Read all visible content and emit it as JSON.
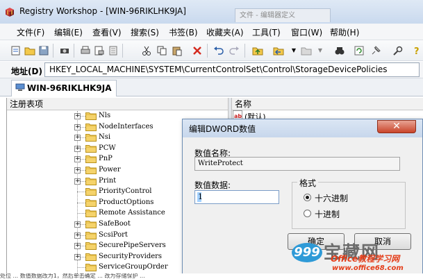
{
  "window": {
    "title": "Registry Workshop - [WIN-96RIKLHK9JA]",
    "background_tab": "文件 - 编辑器定义"
  },
  "menu": [
    {
      "label": "文件(F)"
    },
    {
      "label": "编辑(E)"
    },
    {
      "label": "查看(V)"
    },
    {
      "label": "搜索(S)"
    },
    {
      "label": "书签(B)"
    },
    {
      "label": "收藏夹(A)"
    },
    {
      "label": "工具(T)"
    },
    {
      "label": "窗口(W)"
    },
    {
      "label": "帮助(H)"
    }
  ],
  "address": {
    "label": "地址(D)",
    "path": "HKEY_LOCAL_MACHINE\\SYSTEM\\CurrentControlSet\\Control\\StorageDevicePolicies"
  },
  "host_tab": "WIN-96RIKLHK9JA",
  "left_pane": {
    "header": "注册表项"
  },
  "right_pane": {
    "header": "名称",
    "value_name": "(默认)"
  },
  "tree": [
    {
      "label": "Nls",
      "expandable": true
    },
    {
      "label": "NodeInterfaces",
      "expandable": true
    },
    {
      "label": "Nsi",
      "expandable": true
    },
    {
      "label": "PCW",
      "expandable": true
    },
    {
      "label": "PnP",
      "expandable": true
    },
    {
      "label": "Power",
      "expandable": true
    },
    {
      "label": "Print",
      "expandable": true
    },
    {
      "label": "PriorityControl",
      "expandable": false
    },
    {
      "label": "ProductOptions",
      "expandable": false
    },
    {
      "label": "Remote Assistance",
      "expandable": false
    },
    {
      "label": "SafeBoot",
      "expandable": true
    },
    {
      "label": "ScsiPort",
      "expandable": true
    },
    {
      "label": "SecurePipeServers",
      "expandable": true
    },
    {
      "label": "SecurityProviders",
      "expandable": true
    },
    {
      "label": "ServiceGroupOrder",
      "expandable": false
    }
  ],
  "dialog": {
    "title": "编辑DWORD数值",
    "close_symbol": "✕",
    "value_name_label": "数值名称:",
    "value_name": "WriteProtect",
    "value_data_label": "数值数据:",
    "value_data": "1",
    "base_label": "格式",
    "radio_hex": "十六进制",
    "radio_dec": "十进制",
    "selected_base": "hex",
    "ok": "确定",
    "cancel": "取消"
  },
  "watermark": {
    "bubble": "999",
    "big": "宝藏网",
    "line1": "Office教程学习网",
    "line2": "www.office68.com"
  },
  "caption_fragment": "处位 ... 数值数据改为1，然后单击确定 ... 改为存储保护 ...",
  "colors": {
    "accent": "#3399ff",
    "close": "#c9452b",
    "watermark_red": "#e43c18",
    "watermark_blue": "#2e9ad7"
  },
  "icons": {
    "app": "registry-cube-icon",
    "toolbar": [
      "open-registry-icon",
      "open-folder-icon",
      "save-icon",
      "connect-icon",
      "print-icon",
      "print-preview-icon",
      "properties-icon",
      "cut-icon",
      "copy-icon",
      "paste-icon",
      "delete-icon",
      "undo-icon",
      "redo-icon",
      "up-level-icon",
      "back-icon",
      "dropdown-arrow",
      "forward-icon",
      "dropdown-arrow",
      "find-icon",
      "refresh-icon",
      "pin-icon",
      "tools-icon",
      "help-icon"
    ]
  }
}
